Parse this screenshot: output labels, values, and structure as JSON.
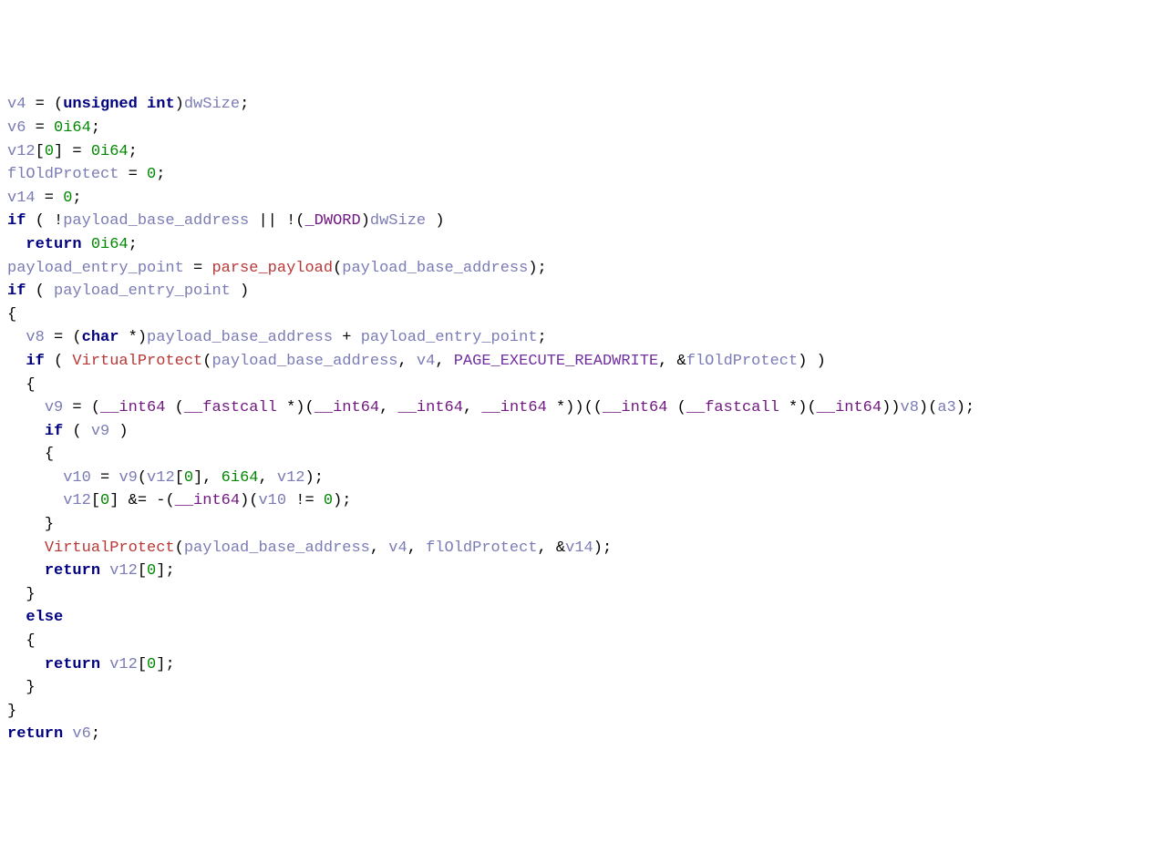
{
  "code": {
    "lines": [
      {
        "indent": 0,
        "tokens": [
          {
            "t": "v",
            "s": "v4"
          },
          {
            "t": "p",
            "s": " = ("
          },
          {
            "t": "k",
            "s": "unsigned"
          },
          {
            "t": "p",
            "s": " "
          },
          {
            "t": "k",
            "s": "int"
          },
          {
            "t": "p",
            "s": ")"
          },
          {
            "t": "v",
            "s": "dwSize"
          },
          {
            "t": "p",
            "s": ";"
          }
        ]
      },
      {
        "indent": 0,
        "tokens": [
          {
            "t": "v",
            "s": "v6"
          },
          {
            "t": "p",
            "s": " = "
          },
          {
            "t": "n",
            "s": "0i64"
          },
          {
            "t": "p",
            "s": ";"
          }
        ]
      },
      {
        "indent": 0,
        "tokens": [
          {
            "t": "v",
            "s": "v12"
          },
          {
            "t": "p",
            "s": "["
          },
          {
            "t": "n",
            "s": "0"
          },
          {
            "t": "p",
            "s": "] = "
          },
          {
            "t": "n",
            "s": "0i64"
          },
          {
            "t": "p",
            "s": ";"
          }
        ]
      },
      {
        "indent": 0,
        "tokens": [
          {
            "t": "v",
            "s": "flOldProtect"
          },
          {
            "t": "p",
            "s": " = "
          },
          {
            "t": "n",
            "s": "0"
          },
          {
            "t": "p",
            "s": ";"
          }
        ]
      },
      {
        "indent": 0,
        "tokens": [
          {
            "t": "v",
            "s": "v14"
          },
          {
            "t": "p",
            "s": " = "
          },
          {
            "t": "n",
            "s": "0"
          },
          {
            "t": "p",
            "s": ";"
          }
        ]
      },
      {
        "indent": 0,
        "tokens": [
          {
            "t": "k",
            "s": "if"
          },
          {
            "t": "p",
            "s": " ( !"
          },
          {
            "t": "v",
            "s": "payload_base_address"
          },
          {
            "t": "p",
            "s": " || !("
          },
          {
            "t": "t",
            "s": "_DWORD"
          },
          {
            "t": "p",
            "s": ")"
          },
          {
            "t": "v",
            "s": "dwSize"
          },
          {
            "t": "p",
            "s": " )"
          }
        ]
      },
      {
        "indent": 1,
        "tokens": [
          {
            "t": "k",
            "s": "return"
          },
          {
            "t": "p",
            "s": " "
          },
          {
            "t": "n",
            "s": "0i64"
          },
          {
            "t": "p",
            "s": ";"
          }
        ]
      },
      {
        "indent": 0,
        "tokens": [
          {
            "t": "v",
            "s": "payload_entry_point"
          },
          {
            "t": "p",
            "s": " = "
          },
          {
            "t": "f",
            "s": "parse_payload"
          },
          {
            "t": "p",
            "s": "("
          },
          {
            "t": "v",
            "s": "payload_base_address"
          },
          {
            "t": "p",
            "s": ");"
          }
        ]
      },
      {
        "indent": 0,
        "tokens": [
          {
            "t": "k",
            "s": "if"
          },
          {
            "t": "p",
            "s": " ( "
          },
          {
            "t": "v",
            "s": "payload_entry_point"
          },
          {
            "t": "p",
            "s": " )"
          }
        ]
      },
      {
        "indent": 0,
        "tokens": [
          {
            "t": "p",
            "s": "{"
          }
        ]
      },
      {
        "indent": 1,
        "tokens": [
          {
            "t": "v",
            "s": "v8"
          },
          {
            "t": "p",
            "s": " = ("
          },
          {
            "t": "k",
            "s": "char"
          },
          {
            "t": "p",
            "s": " *)"
          },
          {
            "t": "v",
            "s": "payload_base_address"
          },
          {
            "t": "p",
            "s": " + "
          },
          {
            "t": "v",
            "s": "payload_entry_point"
          },
          {
            "t": "p",
            "s": ";"
          }
        ]
      },
      {
        "indent": 1,
        "tokens": [
          {
            "t": "k",
            "s": "if"
          },
          {
            "t": "p",
            "s": " ( "
          },
          {
            "t": "f",
            "s": "VirtualProtect"
          },
          {
            "t": "p",
            "s": "("
          },
          {
            "t": "v",
            "s": "payload_base_address"
          },
          {
            "t": "p",
            "s": ", "
          },
          {
            "t": "v",
            "s": "v4"
          },
          {
            "t": "p",
            "s": ", "
          },
          {
            "t": "c",
            "s": "PAGE_EXECUTE_READWRITE"
          },
          {
            "t": "p",
            "s": ", &"
          },
          {
            "t": "v",
            "s": "flOldProtect"
          },
          {
            "t": "p",
            "s": ") )"
          }
        ]
      },
      {
        "indent": 1,
        "tokens": [
          {
            "t": "p",
            "s": "{"
          }
        ]
      },
      {
        "indent": 2,
        "tokens": [
          {
            "t": "v",
            "s": "v9"
          },
          {
            "t": "p",
            "s": " = ("
          },
          {
            "t": "t",
            "s": "__int64"
          },
          {
            "t": "p",
            "s": " ("
          },
          {
            "t": "t",
            "s": "__fastcall"
          },
          {
            "t": "p",
            "s": " *)("
          },
          {
            "t": "t",
            "s": "__int64"
          },
          {
            "t": "p",
            "s": ", "
          },
          {
            "t": "t",
            "s": "__int64"
          },
          {
            "t": "p",
            "s": ", "
          },
          {
            "t": "t",
            "s": "__int64"
          },
          {
            "t": "p",
            "s": " *))(("
          },
          {
            "t": "t",
            "s": "__int64"
          },
          {
            "t": "p",
            "s": " ("
          },
          {
            "t": "t",
            "s": "__fastcall"
          },
          {
            "t": "p",
            "s": " *)("
          },
          {
            "t": "t",
            "s": "__int64"
          },
          {
            "t": "p",
            "s": "))"
          },
          {
            "t": "v",
            "s": "v8"
          },
          {
            "t": "p",
            "s": ")("
          },
          {
            "t": "v",
            "s": "a3"
          },
          {
            "t": "p",
            "s": ");"
          }
        ]
      },
      {
        "indent": 2,
        "tokens": [
          {
            "t": "k",
            "s": "if"
          },
          {
            "t": "p",
            "s": " ( "
          },
          {
            "t": "v",
            "s": "v9"
          },
          {
            "t": "p",
            "s": " )"
          }
        ]
      },
      {
        "indent": 2,
        "tokens": [
          {
            "t": "p",
            "s": "{"
          }
        ]
      },
      {
        "indent": 3,
        "tokens": [
          {
            "t": "v",
            "s": "v10"
          },
          {
            "t": "p",
            "s": " = "
          },
          {
            "t": "v",
            "s": "v9"
          },
          {
            "t": "p",
            "s": "("
          },
          {
            "t": "v",
            "s": "v12"
          },
          {
            "t": "p",
            "s": "["
          },
          {
            "t": "n",
            "s": "0"
          },
          {
            "t": "p",
            "s": "], "
          },
          {
            "t": "n",
            "s": "6i64"
          },
          {
            "t": "p",
            "s": ", "
          },
          {
            "t": "v",
            "s": "v12"
          },
          {
            "t": "p",
            "s": ");"
          }
        ]
      },
      {
        "indent": 3,
        "tokens": [
          {
            "t": "v",
            "s": "v12"
          },
          {
            "t": "p",
            "s": "["
          },
          {
            "t": "n",
            "s": "0"
          },
          {
            "t": "p",
            "s": "] &= -("
          },
          {
            "t": "t",
            "s": "__int64"
          },
          {
            "t": "p",
            "s": ")("
          },
          {
            "t": "v",
            "s": "v10"
          },
          {
            "t": "p",
            "s": " != "
          },
          {
            "t": "n",
            "s": "0"
          },
          {
            "t": "p",
            "s": ");"
          }
        ]
      },
      {
        "indent": 2,
        "tokens": [
          {
            "t": "p",
            "s": "}"
          }
        ]
      },
      {
        "indent": 2,
        "tokens": [
          {
            "t": "f",
            "s": "VirtualProtect"
          },
          {
            "t": "p",
            "s": "("
          },
          {
            "t": "v",
            "s": "payload_base_address"
          },
          {
            "t": "p",
            "s": ", "
          },
          {
            "t": "v",
            "s": "v4"
          },
          {
            "t": "p",
            "s": ", "
          },
          {
            "t": "v",
            "s": "flOldProtect"
          },
          {
            "t": "p",
            "s": ", &"
          },
          {
            "t": "v",
            "s": "v14"
          },
          {
            "t": "p",
            "s": ");"
          }
        ]
      },
      {
        "indent": 2,
        "tokens": [
          {
            "t": "k",
            "s": "return"
          },
          {
            "t": "p",
            "s": " "
          },
          {
            "t": "v",
            "s": "v12"
          },
          {
            "t": "p",
            "s": "["
          },
          {
            "t": "n",
            "s": "0"
          },
          {
            "t": "p",
            "s": "];"
          }
        ]
      },
      {
        "indent": 1,
        "tokens": [
          {
            "t": "p",
            "s": "}"
          }
        ]
      },
      {
        "indent": 1,
        "tokens": [
          {
            "t": "k",
            "s": "else"
          }
        ]
      },
      {
        "indent": 1,
        "tokens": [
          {
            "t": "p",
            "s": "{"
          }
        ]
      },
      {
        "indent": 2,
        "tokens": [
          {
            "t": "k",
            "s": "return"
          },
          {
            "t": "p",
            "s": " "
          },
          {
            "t": "v",
            "s": "v12"
          },
          {
            "t": "p",
            "s": "["
          },
          {
            "t": "n",
            "s": "0"
          },
          {
            "t": "p",
            "s": "];"
          }
        ]
      },
      {
        "indent": 1,
        "tokens": [
          {
            "t": "p",
            "s": "}"
          }
        ]
      },
      {
        "indent": 0,
        "tokens": [
          {
            "t": "p",
            "s": "}"
          }
        ]
      },
      {
        "indent": 0,
        "tokens": [
          {
            "t": "k",
            "s": "return"
          },
          {
            "t": "p",
            "s": " "
          },
          {
            "t": "v",
            "s": "v6"
          },
          {
            "t": "p",
            "s": ";"
          }
        ]
      }
    ]
  }
}
